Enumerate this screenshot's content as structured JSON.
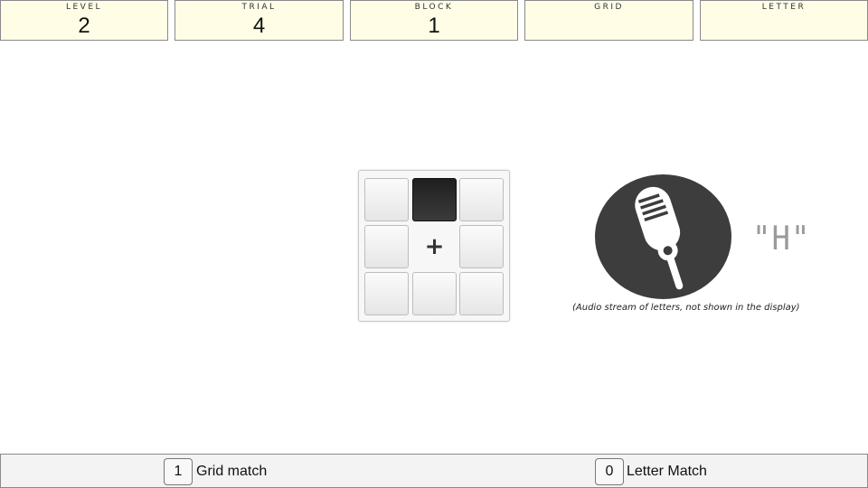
{
  "stats": {
    "level": {
      "label": "LEVEL",
      "value": "2"
    },
    "trial": {
      "label": "TRIAL",
      "value": "4"
    },
    "block": {
      "label": "BLOCK",
      "value": "1"
    },
    "grid": {
      "label": "GRID",
      "value": ""
    },
    "letter": {
      "label": "LETTER",
      "value": ""
    }
  },
  "grid": {
    "fixation": "+",
    "active_cell": "top-middle",
    "icons": {
      "active": "filled-square",
      "inactive": "empty-square"
    }
  },
  "audio": {
    "icon": "microphone-icon",
    "letter": "\"H\"",
    "note": "(Audio stream of letters, not shown in the display)"
  },
  "controls": {
    "grid_match": {
      "key": "1",
      "label": "Grid match"
    },
    "letter_match": {
      "key": "0",
      "label": "Letter Match"
    }
  },
  "colors": {
    "stat_background": "#fffde6",
    "active_cell": "#2a2a2a",
    "mic_background": "#3d3d3d",
    "audio_letter": "#9a9a9a"
  }
}
